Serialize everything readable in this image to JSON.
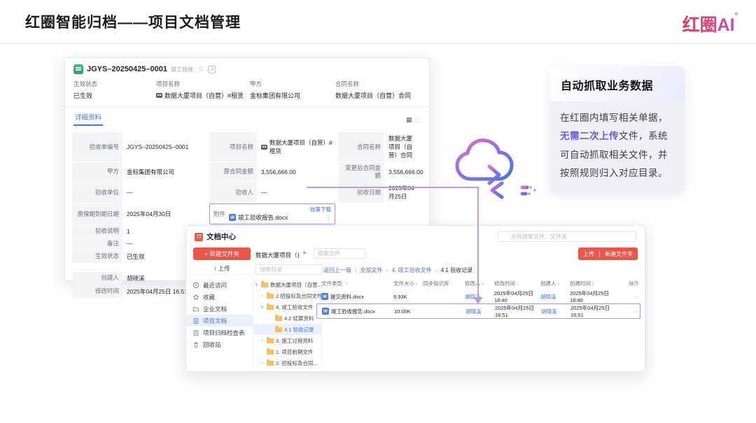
{
  "slide": {
    "title": "红圈智能归档——项目文档管理",
    "logo_text": "红圈AI",
    "logo_superscript": "°"
  },
  "callout": {
    "title": "自动抓取业务数据",
    "body_pre": "在红圈内填写相关单据，",
    "highlight": "无需二次上传",
    "body_post": "文件，系统可自动抓取相关文件，并按照规则归入对应目录。"
  },
  "window1": {
    "title": "JGYS–20250425–0001",
    "subtitle": "竣工验收",
    "star_icon": "☆",
    "external_icon": "↗",
    "grid_view_icon": "▦",
    "card_view_icon": "▢",
    "summary_fields": [
      {
        "label": "生效状态",
        "value": "已生效"
      },
      {
        "label": "项目名称",
        "value": "数据大厦项目（自营）#租赁"
      },
      {
        "label": "甲方",
        "value": "金标集团有限公司"
      },
      {
        "label": "合同名称",
        "value": "数据大厦项目（自营）合同"
      }
    ],
    "tab": "详细资料",
    "detail_rows": [
      {
        "c1_label": "验收单编号",
        "c1_value": "JGYS–20250425–0001",
        "c2_label": "项目名称",
        "c2_value": "数据大厦项目（自营）#租赁",
        "c3_label": "合同名称",
        "c3_value": "数据大厦项目（自营）合同"
      },
      {
        "c1_label": "甲方",
        "c1_value": "金标集团有限公司",
        "c2_label": "原合同金额",
        "c2_value": "3,556,666.00",
        "c3_label": "变更后合同金额",
        "c3_value": "3,556,666.00"
      },
      {
        "c1_label": "验收单位",
        "c1_value": "—",
        "c2_label": "验收人",
        "c2_value": "—",
        "c3_label": "验收日期",
        "c3_value": "2025年04月25日"
      }
    ],
    "warranty_label": "质保期到期日期",
    "warranty_value": "2025年04月30日",
    "attachment": {
      "label": "附件",
      "batch_download": "批量下载",
      "file_icon": "W",
      "file_name": "竣工验收报告.docx",
      "more_icon": "⋮"
    },
    "extra_rows": [
      {
        "label": "验收说明",
        "value": "1"
      },
      {
        "label": "备注",
        "value": "—"
      },
      {
        "label": "生效状态",
        "value": "已生效"
      }
    ],
    "footer_rows": [
      {
        "label": "创建人",
        "value": "胡晓溪"
      },
      {
        "label": "修改时间",
        "value": "2025年04月25日 16:51"
      }
    ]
  },
  "window2": {
    "title": "文档中心",
    "new_folder_button": "+ 新建文件夹",
    "upload_button": "↑ 上传",
    "project_tab": "数据大厦项目（自营...",
    "add_tab": "+",
    "search_file_placeholder": "搜索文件",
    "search_dir_placeholder": "搜索目录",
    "global_search_placeholder": "全局搜索文件、文件夹",
    "top_upload_button": "上传",
    "top_new_folder_button": "新建文件夹",
    "breadcrumb": {
      "back": "返回上一级",
      "divider": "|",
      "sep": "›",
      "items": [
        "全部文件",
        "4. 竣工验收文件",
        "4.1 验收记录"
      ]
    },
    "nav_items": [
      {
        "label": "最近访问"
      },
      {
        "label": "收藏"
      },
      {
        "label": "企业文档"
      },
      {
        "label": "项目文档"
      },
      {
        "label": "项目归档检查表"
      },
      {
        "label": "回收站"
      }
    ],
    "tree_items": [
      {
        "caret": "∨",
        "label": "数据大厦项目（自营..."
      },
      {
        "caret": "›",
        "label": "2.招投标及合同文件"
      },
      {
        "caret": "∨",
        "label": "4. 竣工验收文件"
      },
      {
        "caret": "",
        "label": "4.2 结算资料"
      },
      {
        "caret": "",
        "label": "4.1 验收记录"
      },
      {
        "caret": "›",
        "label": "3. 施工过程资料"
      },
      {
        "caret": "",
        "label": "1. 项目前期文件"
      },
      {
        "caret": "›",
        "label": "2. 招投标及合同..."
      }
    ],
    "table": {
      "headers": [
        {
          "label": "文件类型",
          "caret": "∨"
        },
        {
          "label": "文件大小",
          "caret": "∨"
        },
        {
          "label": "同步知识库",
          "caret": ""
        },
        {
          "label": "修改人",
          "caret": "∨"
        },
        {
          "label": "修改时间",
          "caret": "↕"
        },
        {
          "label": "创建人",
          "caret": "∨"
        },
        {
          "label": "创建时间",
          "caret": "∨"
        },
        {
          "label": "操作",
          "caret": ""
        }
      ],
      "rows": [
        {
          "icon": "W",
          "name": "提交资料.docx",
          "size": "9.93K",
          "modifier": "胡晓溪",
          "modified": "2025年04月25日 18:40",
          "creator": "胡晓溪",
          "created": "2025年04月25日 18:40",
          "actions": "···"
        },
        {
          "icon": "W",
          "name": "竣工验收报告.docx",
          "size": "10.00K",
          "modifier": "胡晓溪",
          "modified": "2025年04月25日 16:51",
          "creator": "胡晓溪",
          "created": "2025年04月25日 16:51",
          "actions": "···"
        }
      ]
    }
  },
  "colors": {
    "accent_red": "#ec5548",
    "link_blue": "#3e74f6",
    "highlight_purple": "#b094dd",
    "callout_purple": "#655ce0",
    "folder_yellow": "#f3bf62"
  }
}
